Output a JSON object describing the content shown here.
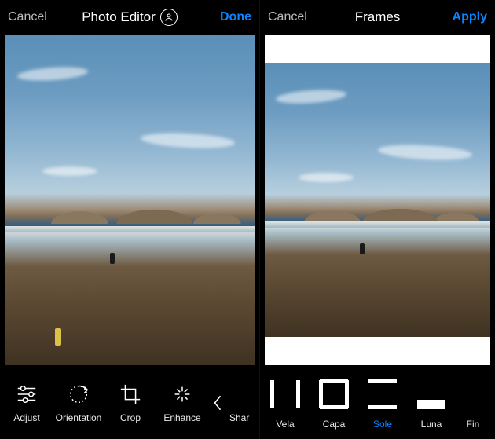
{
  "left": {
    "cancel": "Cancel",
    "title": "Photo Editor",
    "done": "Done",
    "tools": [
      {
        "id": "adjust",
        "label": "Adjust"
      },
      {
        "id": "orientation",
        "label": "Orientation"
      },
      {
        "id": "crop",
        "label": "Crop"
      },
      {
        "id": "enhance",
        "label": "Enhance"
      },
      {
        "id": "sharpen",
        "label": "Shar"
      }
    ]
  },
  "right": {
    "cancel": "Cancel",
    "title": "Frames",
    "apply": "Apply",
    "frames": [
      {
        "id": "vela",
        "label": "Vela",
        "selected": false
      },
      {
        "id": "capa",
        "label": "Capa",
        "selected": false
      },
      {
        "id": "sole",
        "label": "Sole",
        "selected": true
      },
      {
        "id": "luna",
        "label": "Luna",
        "selected": false
      },
      {
        "id": "fine",
        "label": "Fin",
        "selected": false
      }
    ]
  },
  "colors": {
    "accent": "#0a84ff"
  }
}
